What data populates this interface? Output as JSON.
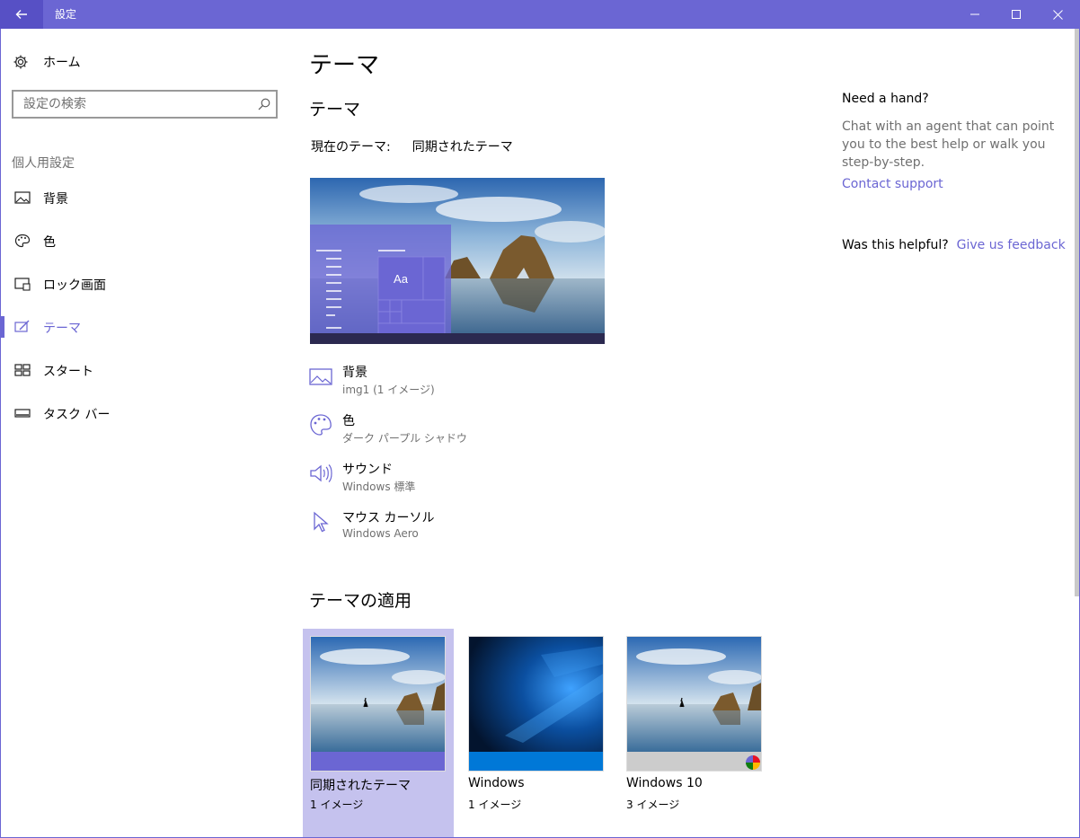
{
  "window": {
    "title": "設定"
  },
  "sidebar": {
    "home_label": "ホーム",
    "search_placeholder": "設定の検索",
    "section_label": "個人用設定",
    "items": [
      {
        "label": "背景",
        "icon": "picture-icon"
      },
      {
        "label": "色",
        "icon": "palette-icon"
      },
      {
        "label": "ロック画面",
        "icon": "lock-screen-icon"
      },
      {
        "label": "テーマ",
        "icon": "theme-brush-icon",
        "active": true
      },
      {
        "label": "スタート",
        "icon": "start-icon"
      },
      {
        "label": "タスク バー",
        "icon": "taskbar-icon"
      }
    ]
  },
  "main": {
    "page_title": "テーマ",
    "section_title": "テーマ",
    "current_theme_label": "現在のテーマ:",
    "current_theme_value": "同期されたテーマ",
    "preview_sample_text": "Aa",
    "properties": [
      {
        "name": "背景",
        "value": "img1 (1 イメージ)",
        "icon": "picture-icon"
      },
      {
        "name": "色",
        "value": "ダーク パープル シャドウ",
        "icon": "palette-icon"
      },
      {
        "name": "サウンド",
        "value": "Windows 標準",
        "icon": "speaker-icon"
      },
      {
        "name": "マウス カーソル",
        "value": "Windows Aero",
        "icon": "cursor-icon"
      }
    ],
    "apply_title": "テーマの適用",
    "themes": [
      {
        "name": "同期されたテーマ",
        "count": "1 イメージ",
        "selected": true
      },
      {
        "name": "Windows",
        "count": "1 イメージ",
        "selected": false
      },
      {
        "name": "Windows 10",
        "count": "3 イメージ",
        "selected": false
      }
    ]
  },
  "help": {
    "title": "Need a hand?",
    "text": "Chat with an agent that can point you to the best help or walk you step-by-step.",
    "contact_link": "Contact support",
    "helpful_question": "Was this helpful?",
    "feedback_link": "Give us feedback"
  },
  "colors": {
    "accent": "#6b66d3",
    "accent_dark": "#5750c5",
    "selected_card": "#c5c2ee",
    "secondary_text": "#707070"
  }
}
